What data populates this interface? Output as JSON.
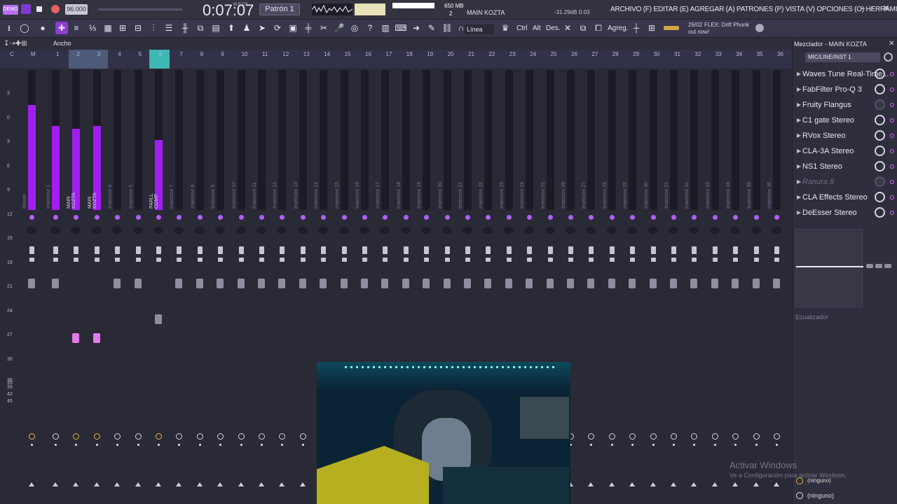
{
  "app": {
    "logo": "DEMO",
    "tempo": "96.000",
    "time": "0:07:07",
    "time_unit": "M:S:CS",
    "pattern": "Patrón 1",
    "cpu": "36",
    "ram": "650 MB",
    "poly": "2",
    "channel_name": "MAIN KOZTA",
    "db": "-31.29dB",
    "db2": "0.03"
  },
  "menu": {
    "text": "ARCHIVO (F) EDITAR (E) AGREGAR (A) PATRONES (P) VISTA (V) OPCIONES (O) HERRAMIENTAS (T) AYUDA"
  },
  "toolbar": {
    "line_mode": "Línea",
    "ctrl": "Ctrl",
    "alt": "Alt",
    "des": "Des.",
    "agregar": "Agreg.",
    "news_date": "26/02",
    "news_text": "FLEX: Drift Phonk",
    "news_sub": "out now!"
  },
  "mixer": {
    "width_label": "Ancho",
    "scale": [
      "3",
      "0",
      "3",
      "6",
      "9",
      "12",
      "15",
      "18",
      "21",
      "24",
      "27",
      "30",
      "33",
      "36",
      "39",
      "42",
      "45"
    ],
    "numbers": [
      "C",
      "M",
      "1",
      "2",
      "3",
      "4",
      "5",
      "6",
      "7",
      "8",
      "9",
      "10",
      "11",
      "12",
      "13",
      "14",
      "15",
      "16",
      "17",
      "18",
      "19",
      "20",
      "21",
      "22",
      "23",
      "24",
      "25",
      "26",
      "27",
      "28",
      "29",
      "30",
      "31",
      "32",
      "33",
      "34",
      "35",
      "36"
    ],
    "tracks": [
      "Master",
      "Inserción 1",
      "MAIN KOZTA",
      "MAIN KOZTA",
      "Inserción 4",
      "Inserción 5",
      "PARLL COMP",
      "Inserción 7",
      "Inserción 8",
      "Inserción 9",
      "Inserción 10",
      "Inserción 11",
      "Inserción 12",
      "Inserción 13",
      "Inserción 14",
      "Inserción 15",
      "Inserción 16",
      "Inserción 17",
      "Inserción 18",
      "Inserción 19",
      "Inserción 20",
      "Inserción 21",
      "Inserción 22",
      "Inserción 23",
      "Inserción 24",
      "Inserción 25",
      "Inserción 26",
      "Inserción 27",
      "Inserción 28",
      "Inserción 29",
      "Inserción 30",
      "Inserción 31",
      "Inserción 32",
      "Inserción 33",
      "Inserción 34",
      "Inserción 35",
      "Inserción 36"
    ],
    "levels": [
      0.75,
      0.6,
      0.58,
      0.6,
      0,
      0,
      0.5,
      0,
      0,
      0,
      0,
      0,
      0,
      0,
      0,
      0,
      0,
      0,
      0,
      0,
      0,
      0,
      0,
      0,
      0,
      0,
      0,
      0,
      0,
      0,
      0,
      0,
      0,
      0,
      0,
      0,
      0
    ]
  },
  "panel": {
    "title": "Mezclador - MAIN KOZTA",
    "input": "MIC/LINE/INST 1",
    "effects": [
      "Waves Tune Real-Time...",
      "FabFilter Pro-Q 3",
      "Fruity Flangus",
      "C1 gate Stereo",
      "RVox Stereo",
      "CLA-3A Stereo",
      "NS1 Stereo",
      "Ranura 8",
      "CLA Effects Stereo",
      "DeEsser Stereo"
    ],
    "eq_label": "Ecualizador",
    "out1": "(ninguno)",
    "out2": "(ninguno)"
  },
  "watermark": {
    "line1": "Activar Windows",
    "line2": "Ve a Configuración para activar Windows."
  },
  "colors": {
    "accent": "#a11ef0",
    "selected": "#8a3fd1",
    "teal": "#3fb7b5"
  }
}
